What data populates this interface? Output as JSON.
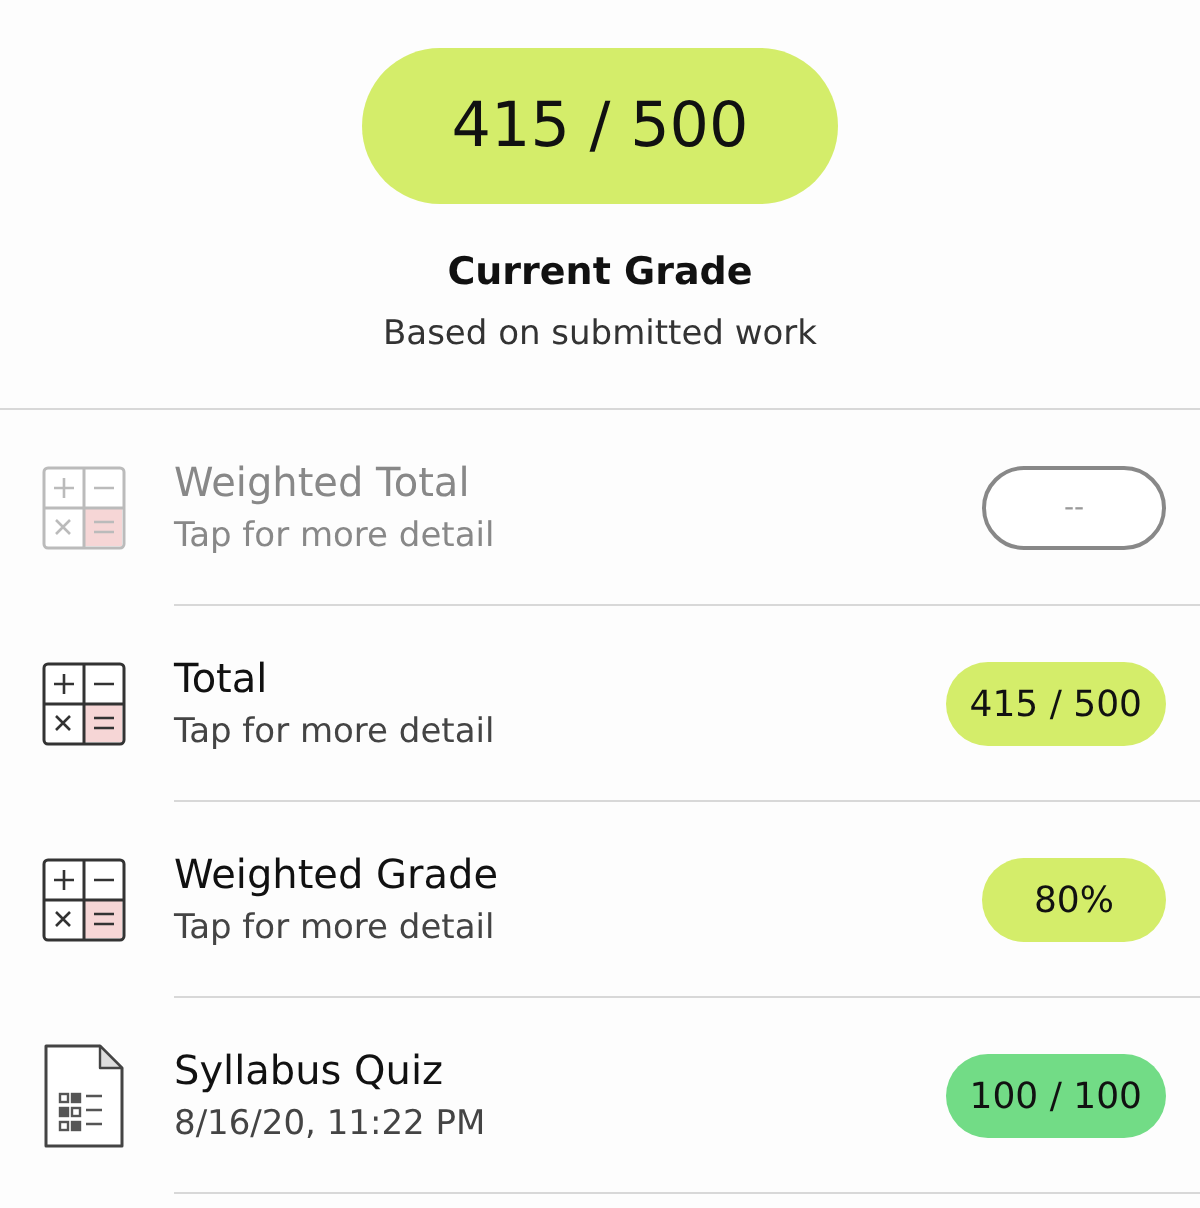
{
  "header": {
    "score": "415 / 500",
    "title": "Current Grade",
    "subtitle": "Based on submitted work"
  },
  "rows": [
    {
      "kind": "calculator",
      "title": "Weighted Total",
      "subtitle": "Tap for more detail",
      "badge": "--",
      "disabled": true
    },
    {
      "kind": "calculator",
      "title": "Total",
      "subtitle": "Tap for more detail",
      "badge": "415 / 500",
      "disabled": false,
      "color": "#d4ed6a"
    },
    {
      "kind": "calculator",
      "title": "Weighted Grade",
      "subtitle": "Tap for more detail",
      "badge": "80%",
      "disabled": false,
      "color": "#d4ed6a"
    },
    {
      "kind": "document",
      "title": "Syllabus Quiz",
      "subtitle": "8/16/20, 11:22 PM",
      "disabled": false,
      "badge": "100 / 100",
      "color": "#72dc86"
    }
  ]
}
